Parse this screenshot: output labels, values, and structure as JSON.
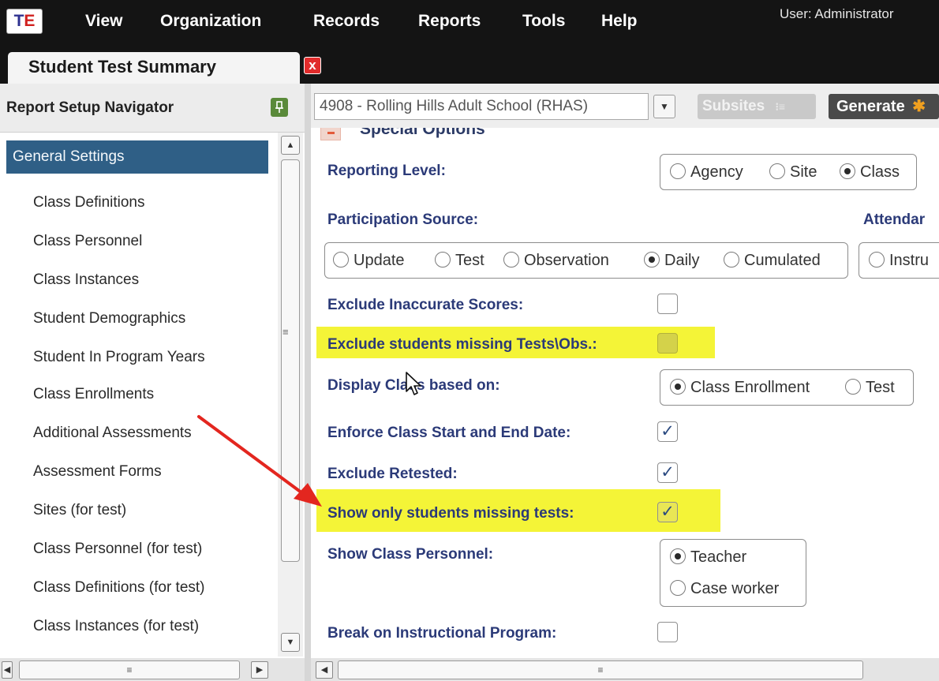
{
  "app": {
    "logo_text_t": "T",
    "logo_text_e": "E",
    "menu": [
      "View",
      "Organization",
      "Records",
      "Reports",
      "Tools",
      "Help"
    ],
    "user_label": "User: Administrator"
  },
  "tab": {
    "title": "Student Test Summary",
    "close_glyph": "x"
  },
  "navigator": {
    "title": "Report Setup Navigator",
    "pin_icon": "pin-icon",
    "items": [
      "General Settings",
      "Class Definitions",
      "Class Personnel",
      "Class Instances",
      "Student Demographics",
      "Student In Program Years",
      "Class Enrollments",
      "Additional Assessments",
      "Assessment Forms",
      "Sites (for test)",
      "Class Personnel (for test)",
      "Class Definitions (for test)",
      "Class Instances (for test)"
    ],
    "selected_index": 0
  },
  "toolbar": {
    "site_value": "4908 - Rolling Hills Adult School (RHAS)",
    "subsites_label": "Subsites",
    "generate_label": "Generate"
  },
  "options": {
    "section_title": "Special Options",
    "reporting_level": {
      "label": "Reporting Level:",
      "choices": [
        "Agency",
        "Site",
        "Class"
      ],
      "selected": "Class"
    },
    "participation_source": {
      "label": "Participation Source:",
      "choices": [
        "Update",
        "Test",
        "Observation",
        "Daily",
        "Cumulated"
      ],
      "selected": "Daily"
    },
    "attendance": {
      "label": "Attendar",
      "first_choice": "Instru"
    },
    "exclude_inaccurate": {
      "label": "Exclude Inaccurate Scores:",
      "checked": false
    },
    "exclude_missing": {
      "label": "Exclude students missing Tests\\Obs.:",
      "checked": false
    },
    "display_class": {
      "label": "Display Class based on:",
      "choices": [
        "Class Enrollment",
        "Test"
      ],
      "selected": "Class Enrollment"
    },
    "enforce_dates": {
      "label": "Enforce Class Start and End Date:",
      "checked": true
    },
    "exclude_retested": {
      "label": "Exclude Retested:",
      "checked": true
    },
    "show_missing": {
      "label": "Show only students missing tests:",
      "checked": true
    },
    "show_personnel": {
      "label": "Show Class Personnel:",
      "choices": [
        "Teacher",
        "Case worker"
      ],
      "selected": "Teacher"
    },
    "break_program": {
      "label": "Break on Instructional Program:",
      "checked": false
    }
  },
  "colors": {
    "menubar": "#141414",
    "nav_selected": "#2f5f86",
    "label_text": "#2b3a78",
    "highlight": "#f4f437",
    "annotation_arrow": "#e3261f"
  }
}
